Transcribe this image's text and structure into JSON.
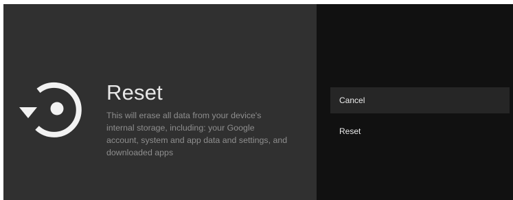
{
  "dialog": {
    "icon": "reset-icon",
    "title": "Reset",
    "description": "This will erase all data from your device's internal storage, including: your Google account, system and app data and settings, and downloaded apps"
  },
  "actions": {
    "cancel_label": "Cancel",
    "reset_label": "Reset",
    "focused": "Cancel"
  },
  "colors": {
    "left_panel_bg": "#303030",
    "right_panel_bg": "#111111",
    "focused_item_bg": "#262626",
    "title_text": "#e8e8e8",
    "description_text": "#8e8e8e"
  }
}
